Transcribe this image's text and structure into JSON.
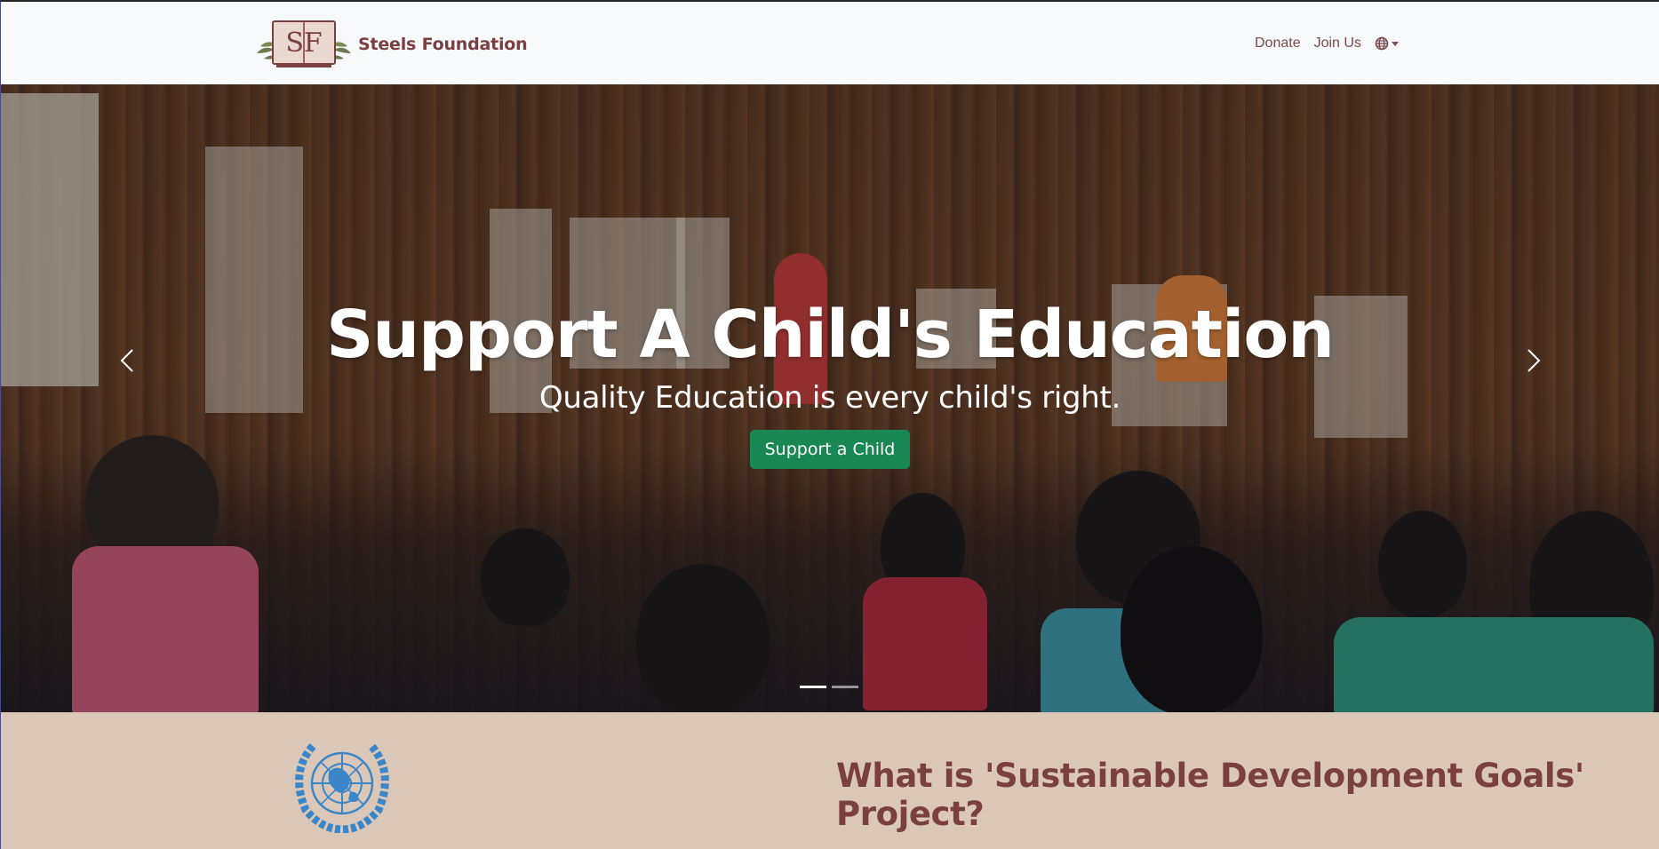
{
  "navbar": {
    "logo_letters": "SF",
    "brand_name": "Steels Foundation",
    "links": [
      {
        "label": "Donate"
      },
      {
        "label": "Join Us"
      }
    ],
    "language_icon": "globe-icon"
  },
  "hero": {
    "title": "Support A Child's Education",
    "subtitle": "Quality Education is every child's right.",
    "cta_label": "Support a Child",
    "cta_color": "#198754",
    "slides_count": 2,
    "active_slide": 1,
    "prev_icon": "chevron-left-icon",
    "next_icon": "chevron-right-icon"
  },
  "sdg_section": {
    "emblem": "un-emblem-icon",
    "emblem_color": "#3a86c8",
    "title": "What is 'Sustainable Development Goals' Project?",
    "title_color": "#7c3f3f",
    "background": "#dbc7b8"
  },
  "colors": {
    "brand": "#7c3f3f",
    "navbar_bg": "#f8f9fb",
    "button_green": "#198754"
  }
}
